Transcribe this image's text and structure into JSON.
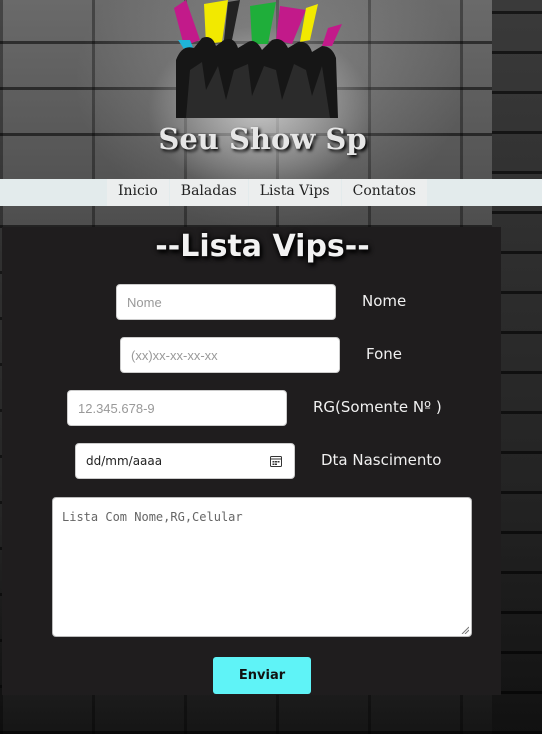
{
  "header": {
    "site_title": "Seu Show Sp"
  },
  "nav": {
    "items": [
      {
        "label": "Inicio"
      },
      {
        "label": "Baladas"
      },
      {
        "label": "Lista Vips"
      },
      {
        "label": "Contatos"
      }
    ]
  },
  "form": {
    "title": "--Lista Vips--",
    "nome": {
      "placeholder": "Nome",
      "label": "Nome"
    },
    "fone": {
      "placeholder": "(xx)xx-xx-xx-xx",
      "label": "Fone"
    },
    "rg": {
      "placeholder": "12.345.678-9",
      "label": "RG(Somente Nº )"
    },
    "nascimento": {
      "value": "dd/mm/aaaa",
      "label": "Dta Nascimento"
    },
    "lista": {
      "placeholder": "Lista Com Nome,RG,Celular"
    },
    "submit_label": "Enviar"
  },
  "colors": {
    "panel": "#1f1d1e",
    "navbar": "#e3ebec",
    "submit": "#5ff3f7"
  },
  "icons": [
    "logo-crowd-icon",
    "calendar-icon",
    "resize-handle-icon"
  ]
}
